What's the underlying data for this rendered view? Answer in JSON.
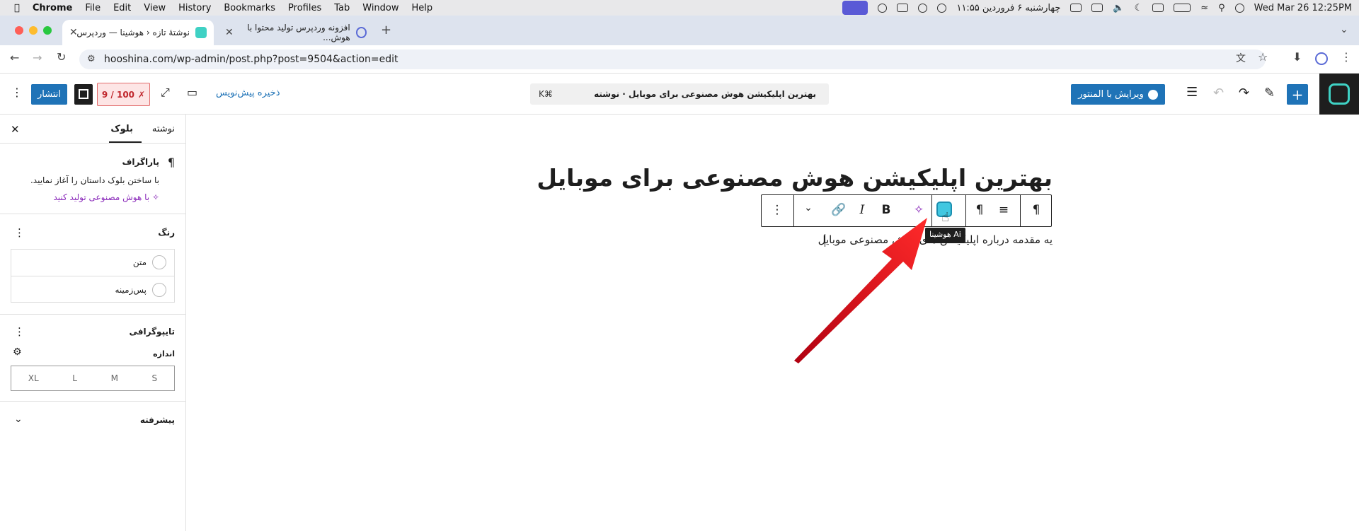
{
  "menubar": {
    "app": "Chrome",
    "items": [
      "File",
      "Edit",
      "View",
      "History",
      "Bookmarks",
      "Profiles",
      "Tab",
      "Window",
      "Help"
    ],
    "persian_date": "چهارشنبه ۶ فروردین ۱۱:۵۵",
    "clock": "Wed Mar 26  12:25PM"
  },
  "tabs": [
    {
      "title": "نوشتهٔ تازه ‹ هوشینا — وردپرس",
      "active": true
    },
    {
      "title": "افزونه وردپرس تولید محتوا با هوش...",
      "active": false
    }
  ],
  "address": {
    "url": "hooshina.com/wp-admin/post.php?post=9504&action=edit"
  },
  "wp_header": {
    "publish": "انتشار",
    "score": "9 / 100",
    "save_draft": "ذخیره پیش‌نویس",
    "command_title": "بهترین اپلیکیشن هوش مصنوعی برای موبایل · نوشته",
    "command_shortcut": "⌘K",
    "elementor": "ویرایش با المنتور"
  },
  "sidebar": {
    "tab_post": "نوشته",
    "tab_block": "بلوک",
    "block_name": "پاراگراف",
    "block_desc": "با ساختن بلوک داستان را آغاز نمایید.",
    "ai_link": "با هوش مصنوعی تولید کنید",
    "color_heading": "رنگ",
    "color_text": "متن",
    "color_bg": "پس‌زمینه",
    "typography": "تایپوگرافی",
    "size_label": "اندازه",
    "sizes": [
      "XL",
      "L",
      "M",
      "S"
    ],
    "advanced": "پیشرفته"
  },
  "editor": {
    "title": "بهترین اپلیکیشن هوش مصنوعی برای موبایل",
    "paragraph": "یه مقدمه درباره اپلیکیشن های هوش مصنوعی موبایل",
    "tooltip": "هوشینا Ai"
  },
  "colors": {
    "accent": "#1f73b7",
    "ai_purple": "#8c2dbb",
    "arrow": "#e3141b"
  }
}
